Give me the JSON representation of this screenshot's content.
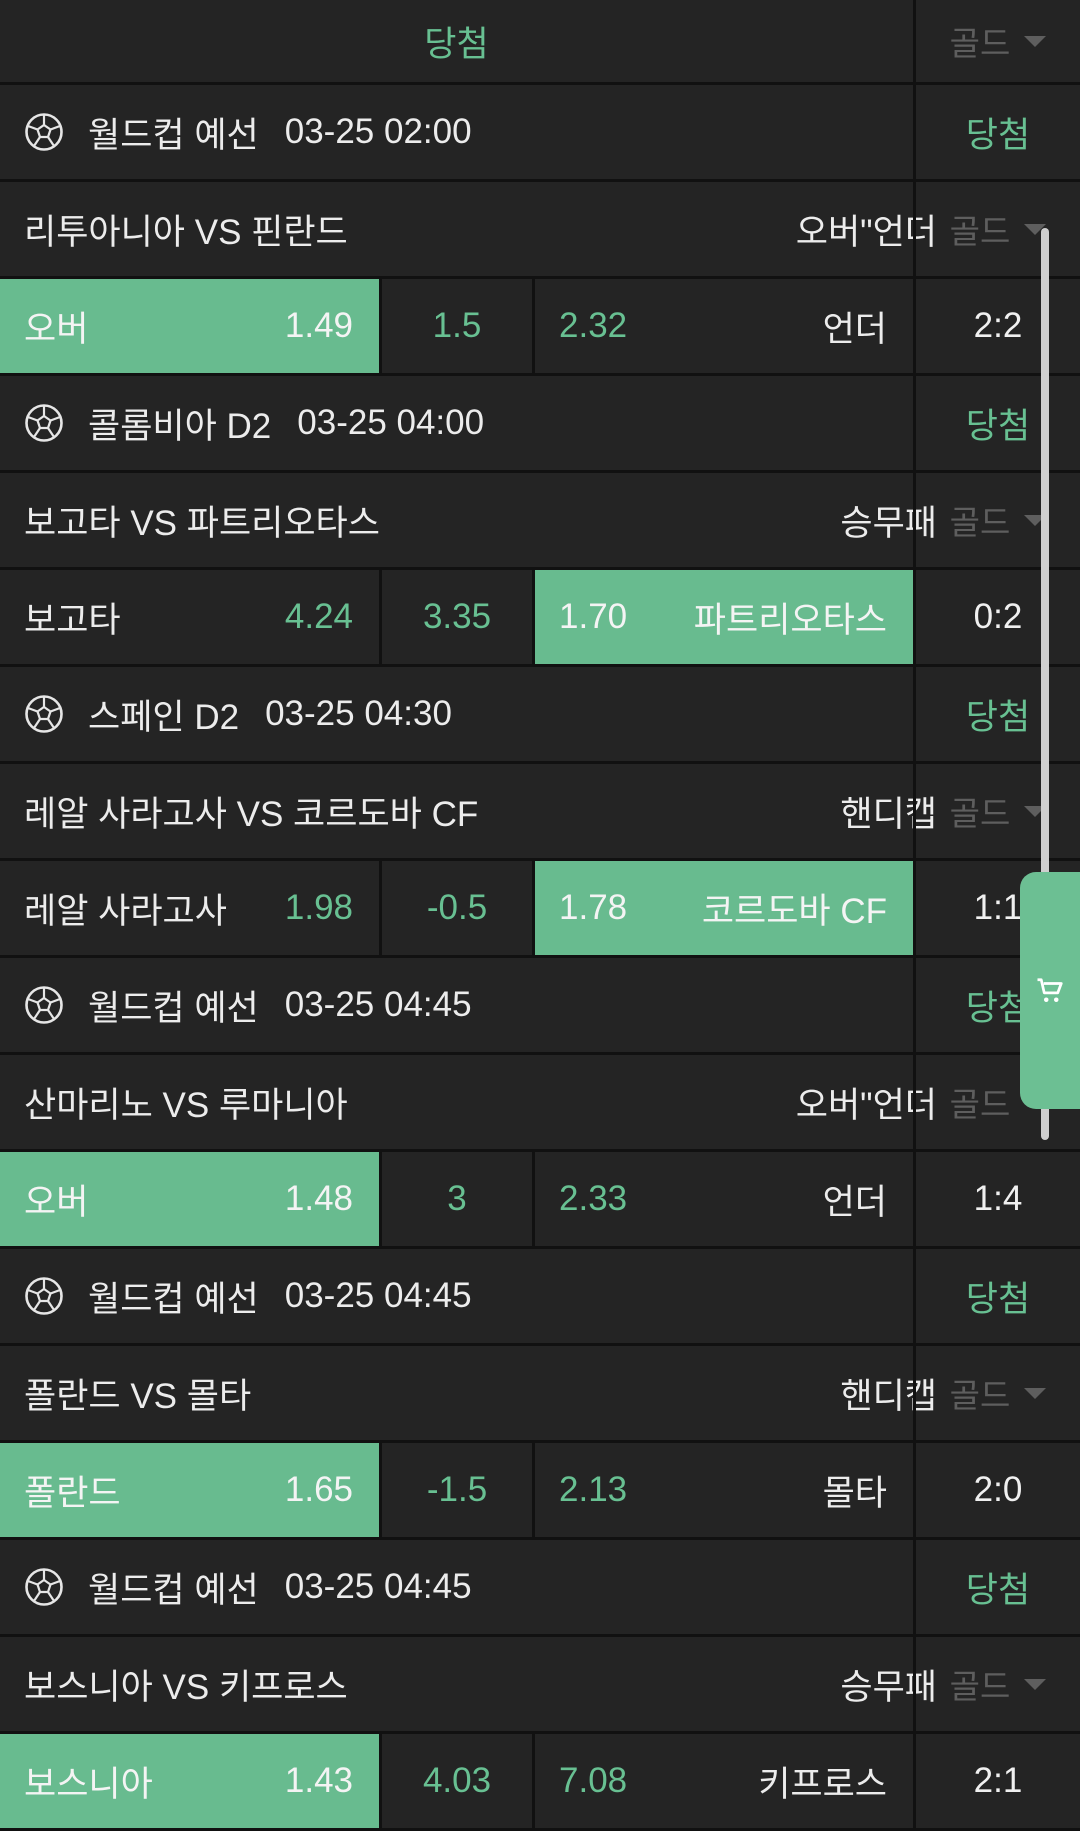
{
  "header": {
    "title": "당첨",
    "side_label": "골드"
  },
  "blocks": [
    {
      "league": "월드컵 예선",
      "time": "03-25 02:00",
      "result": "당첨",
      "match": "리투아니아 VS 핀란드",
      "market": "오버\"언더",
      "side_label": "골드",
      "left_label": "오버",
      "left_odds": "1.49",
      "line": "1.5",
      "right_odds": "2.32",
      "right_label": "언더",
      "score": "2:2",
      "selected": "left"
    },
    {
      "league": "콜롬비아 D2",
      "time": "03-25 04:00",
      "result": "당첨",
      "match": "보고타 VS 파트리오타스",
      "market": "승무패",
      "side_label": "골드",
      "left_label": "보고타",
      "left_odds": "4.24",
      "line": "3.35",
      "right_odds": "1.70",
      "right_label": "파트리오타스",
      "score": "0:2",
      "selected": "right"
    },
    {
      "league": "스페인 D2",
      "time": "03-25 04:30",
      "result": "당첨",
      "match": "레알 사라고사 VS 코르도바 CF",
      "market": "핸디캡",
      "side_label": "골드",
      "left_label": "레알 사라고사",
      "left_odds": "1.98",
      "line": "-0.5",
      "right_odds": "1.78",
      "right_label": "코르도바 CF",
      "score": "1:1",
      "selected": "right"
    },
    {
      "league": "월드컵 예선",
      "time": "03-25 04:45",
      "result": "당첨",
      "match": "산마리노 VS 루마니아",
      "market": "오버\"언더",
      "side_label": "골드",
      "left_label": "오버",
      "left_odds": "1.48",
      "line": "3",
      "right_odds": "2.33",
      "right_label": "언더",
      "score": "1:4",
      "selected": "left"
    },
    {
      "league": "월드컵 예선",
      "time": "03-25 04:45",
      "result": "당첨",
      "match": "폴란드 VS 몰타",
      "market": "핸디캡",
      "side_label": "골드",
      "left_label": "폴란드",
      "left_odds": "1.65",
      "line": "-1.5",
      "right_odds": "2.13",
      "right_label": "몰타",
      "score": "2:0",
      "selected": "left"
    },
    {
      "league": "월드컵 예선",
      "time": "03-25 04:45",
      "result": "당첨",
      "match": "보스니아 VS 키프로스",
      "market": "승무패",
      "side_label": "골드",
      "left_label": "보스니아",
      "left_odds": "1.43",
      "line": "4.03",
      "right_odds": "7.08",
      "right_label": "키프로스",
      "score": "2:1",
      "selected": "left"
    }
  ],
  "colors": {
    "accent": "#68bb8f",
    "background": "#242424",
    "divider": "#111111"
  },
  "icons": {
    "league": "soccer-ball-icon",
    "dropdown": "caret-down-icon",
    "cart": "cart-icon"
  }
}
